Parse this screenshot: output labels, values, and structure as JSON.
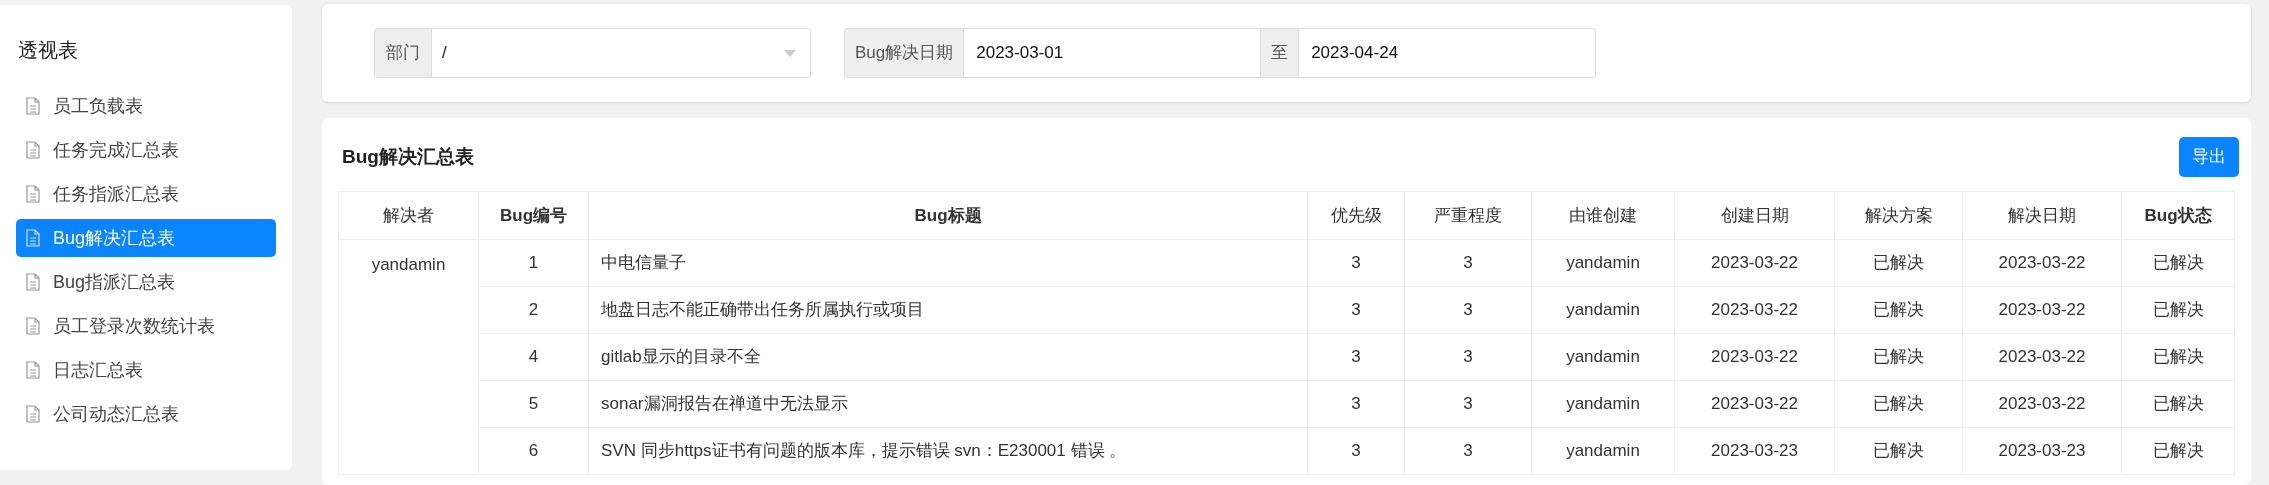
{
  "sidebar": {
    "title": "透视表",
    "items": [
      {
        "label": "员工负载表",
        "selected": false
      },
      {
        "label": "任务完成汇总表",
        "selected": false
      },
      {
        "label": "任务指派汇总表",
        "selected": false
      },
      {
        "label": "Bug解决汇总表",
        "selected": true
      },
      {
        "label": "Bug指派汇总表",
        "selected": false
      },
      {
        "label": "员工登录次数统计表",
        "selected": false
      },
      {
        "label": "日志汇总表",
        "selected": false
      },
      {
        "label": "公司动态汇总表",
        "selected": false
      }
    ]
  },
  "filters": {
    "department": {
      "label": "部门",
      "value": "/"
    },
    "date_range": {
      "label": "Bug解决日期",
      "from": "2023-03-01",
      "separator": "至",
      "to": "2023-04-24"
    }
  },
  "report": {
    "title": "Bug解决汇总表",
    "export_button": "导出",
    "columns": [
      "解决者",
      "Bug编号",
      "Bug标题",
      "优先级",
      "严重程度",
      "由谁创建",
      "创建日期",
      "解决方案",
      "解决日期",
      "Bug状态"
    ],
    "rows": [
      [
        {
          "text": "yandamin",
          "rowspan": 5
        },
        "1",
        "中电信量子",
        "3",
        "3",
        "yandamin",
        "2023-03-22",
        "已解决",
        "2023-03-22",
        "已解决"
      ],
      [
        "2",
        "地盘日志不能正确带出任务所属执行或项目",
        "3",
        "3",
        "yandamin",
        "2023-03-22",
        "已解决",
        "2023-03-22",
        "已解决"
      ],
      [
        "4",
        "gitlab显示的目录不全",
        "3",
        "3",
        "yandamin",
        "2023-03-22",
        "已解决",
        "2023-03-22",
        "已解决"
      ],
      [
        "5",
        "sonar漏洞报告在禅道中无法显示",
        "3",
        "3",
        "yandamin",
        "2023-03-22",
        "已解决",
        "2023-03-22",
        "已解决"
      ],
      [
        "6",
        "SVN 同步https证书有问题的版本库，提示错误 svn：E230001 错误 。",
        "3",
        "3",
        "yandamin",
        "2023-03-23",
        "已解决",
        "2023-03-23",
        "已解决"
      ]
    ]
  }
}
